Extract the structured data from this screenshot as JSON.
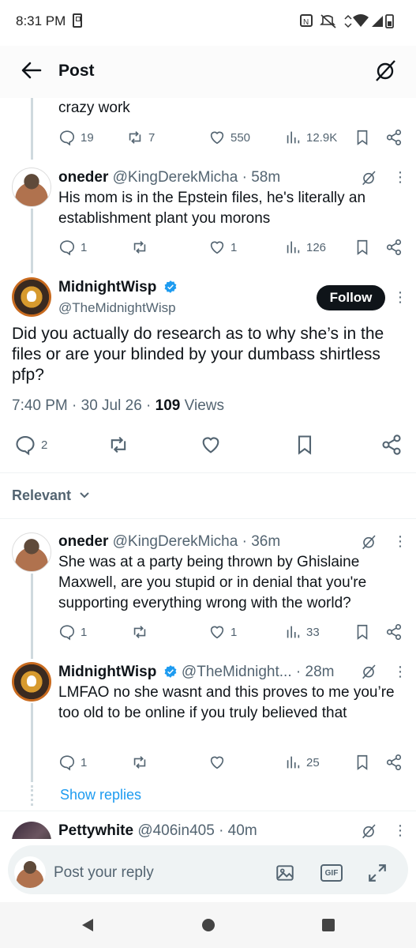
{
  "status_bar": {
    "time": "8:31 PM"
  },
  "header": {
    "title": "Post"
  },
  "top_reply": {
    "text": "crazy work",
    "replies": "19",
    "reposts": "7",
    "likes": "550",
    "views": "12.9K"
  },
  "parent_reply": {
    "name": "oneder",
    "handle": "@KingDerekMicha",
    "time": "· 58m",
    "text": "His mom is in the Epstein files, he's literally an establishment plant you morons",
    "replies": "1",
    "reposts": "",
    "likes": "1",
    "views": "126"
  },
  "main_post": {
    "name": "MidnightWisp",
    "handle": "@TheMidnightWisp",
    "follow_label": "Follow",
    "text": "Did you actually do research as to why she’s in the files or are your blinded by your dumbass shirtless pfp?",
    "timestamp": "7:40 PM · 30 Jul 26 · ",
    "views_count": "109",
    "views_label": " Views",
    "replies": "2"
  },
  "sort": {
    "label": "Relevant"
  },
  "replies": [
    {
      "name": "oneder",
      "handle": "@KingDerekMicha",
      "time": "· 36m",
      "text": "She was at a party being thrown by Ghislaine Maxwell, are you stupid or in denial that you're supporting everything wrong with the world?",
      "replies": "1",
      "likes": "1",
      "views": "33"
    },
    {
      "name": "MidnightWisp",
      "handle": "@TheMidnight...",
      "time": "· 28m",
      "text": "LMFAO no she wasnt and this proves to me you’re too old to be online if you truly believed that",
      "replies": "1",
      "likes": "",
      "views": "25"
    },
    {
      "name": "Pettywhite",
      "handle": "@406in405",
      "time": "· 40m"
    }
  ],
  "show_replies_label": "Show replies",
  "reply_bar": {
    "placeholder": "Post your reply",
    "gif_label": "GIF"
  },
  "colors": {
    "accent": "#1d9bf0",
    "text": "#0f1419",
    "muted": "#536471",
    "follow_bg": "#0f1419"
  }
}
